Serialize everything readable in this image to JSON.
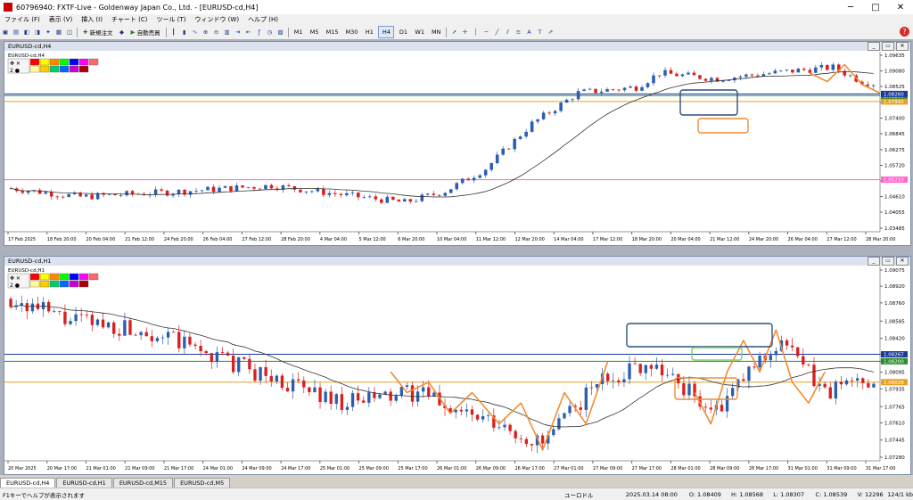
{
  "window": {
    "title": "60796940: FXTF-Live - Goldenway Japan Co., Ltd. - [EURUSD-cd,H4]"
  },
  "menu": [
    "ファイル (F)",
    "表示 (V)",
    "挿入 (I)",
    "チャート (C)",
    "ツール (T)",
    "ウィンドウ (W)",
    "ヘルプ (H)"
  ],
  "toolbar": {
    "new_order": "新規注文",
    "auto_trade": "自動売買",
    "periods": [
      "M1",
      "M5",
      "M15",
      "M30",
      "H1",
      "H4",
      "D1",
      "W1",
      "MN"
    ],
    "selected_period": "H4"
  },
  "charts": [
    {
      "title": "EURUSD-cd,H4",
      "price_labels": [
        "1.09635",
        "1.09080",
        "1.08525",
        "1.07955",
        "1.07400",
        "1.06845",
        "1.06275",
        "1.05720",
        "1.05165",
        "1.04610",
        "1.04055",
        "1.03485"
      ],
      "badges": {
        "blue": "1.08260",
        "green": "1.08200",
        "orange": "1.07990",
        "pink": "1.05210"
      },
      "time_labels": [
        "17 Feb 2025",
        "18 Feb 20:00",
        "20 Feb 04:00",
        "21 Feb 12:00",
        "24 Feb 20:00",
        "26 Feb 04:00",
        "27 Feb 12:00",
        "28 Feb 20:00",
        "4 Mar 04:00",
        "5 Mar 12:00",
        "6 Mar 20:00",
        "10 Mar 04:00",
        "11 Mar 12:00",
        "12 Mar 20:00",
        "14 Mar 04:00",
        "17 Mar 12:00",
        "18 Mar 20:00",
        "20 Mar 04:00",
        "21 Mar 12:00",
        "24 Mar 20:00",
        "26 Mar 04:00",
        "27 Mar 12:00",
        "28 Mar 20:00"
      ],
      "colors": {
        "bull": "#2a5fb0",
        "bear": "#d82020",
        "ma": "#333333",
        "blue_line": "#1a3a9a",
        "green_line": "#2b8b2b",
        "orange_line": "#e8a020",
        "pink_line": "#ff66cc"
      }
    },
    {
      "title": "EURUSD-cd,H1",
      "price_labels": [
        "1.09075",
        "1.08920",
        "1.08760",
        "1.08585",
        "1.08420",
        "1.08267",
        "1.08200",
        "1.08095",
        "1.07935",
        "1.07765",
        "1.07610",
        "1.07445",
        "1.07280"
      ],
      "badges": {
        "blue": "1.08267",
        "green": "1.08200",
        "orange": "1.08028"
      },
      "time_labels": [
        "20 Mar 2025",
        "20 Mar 17:00",
        "21 Mar 01:00",
        "21 Mar 09:00",
        "21 Mar 17:00",
        "24 Mar 01:00",
        "24 Mar 09:00",
        "24 Mar 17:00",
        "25 Mar 01:00",
        "25 Mar 09:00",
        "25 Mar 17:00",
        "26 Mar 01:00",
        "26 Mar 09:00",
        "26 Mar 17:00",
        "27 Mar 01:00",
        "27 Mar 09:00",
        "27 Mar 17:00",
        "28 Mar 01:00",
        "28 Mar 09:00",
        "28 Mar 17:00",
        "31 Mar 01:00",
        "31 Mar 09:00",
        "31 Mar 17:00"
      ],
      "colors": {
        "bull": "#2a5fb0",
        "bear": "#d82020",
        "ma": "#333333",
        "blue_line": "#1a3a9a",
        "green_line": "#2b8b2b",
        "orange_line": "#e8a020",
        "pink_line": "#ff66cc"
      }
    }
  ],
  "tabs": [
    "EURUSD-cd,H4",
    "EURUSD-cd,H1",
    "EURUSD-cd,M15",
    "EURUSD-cd,M5"
  ],
  "status": {
    "help": "F1キーでヘルプが表示されます",
    "profile": "ユーロドル",
    "datetime": "2025.03.14 08:00",
    "open": "O: 1.08409",
    "high": "H: 1.08568",
    "low": "L: 1.08307",
    "close": "C: 1.08539",
    "volume": "V: 12296",
    "traffic": "124/1 kb"
  }
}
